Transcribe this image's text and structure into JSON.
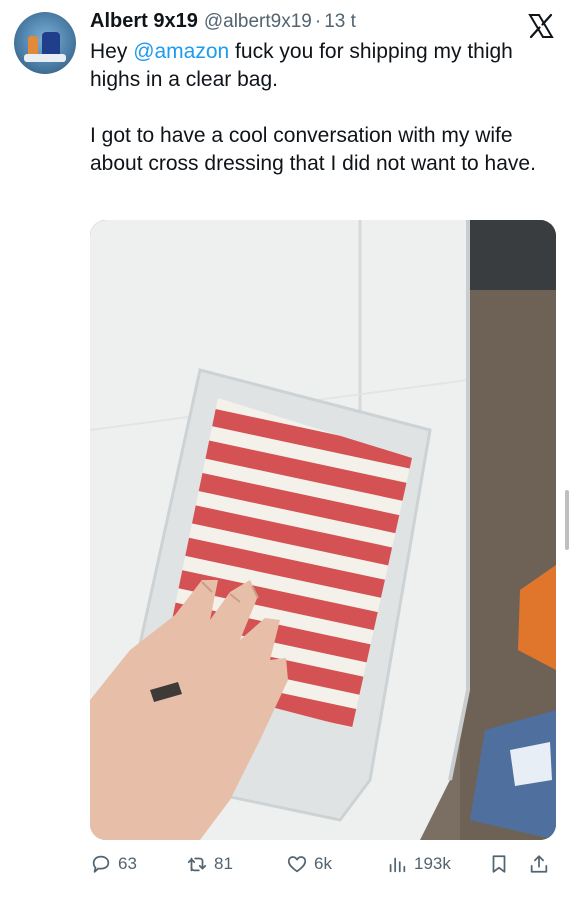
{
  "tweet": {
    "author_name": "Albert 9x19",
    "author_handle": "@albert9x19",
    "separator": "·",
    "time": "13 t",
    "text_prefix": "Hey ",
    "mention": "@amazon",
    "text_suffix": " fuck you for shipping my thigh highs in a clear bag.",
    "text_paragraph_2": "I got to have a cool conversation with my wife about cross dressing that I did not want to have."
  },
  "platform": {
    "logo_icon": "x-logo-icon"
  },
  "media": {
    "icon": "photo",
    "subject": "striped-socks-in-clear-bag"
  },
  "actions": {
    "replies": "63",
    "retweets": "81",
    "likes": "6k",
    "views": "193k"
  },
  "colors": {
    "text": "#0f1419",
    "secondary": "#536471",
    "accent": "#1d9bf0",
    "sock_red": "#cf3b3c"
  }
}
